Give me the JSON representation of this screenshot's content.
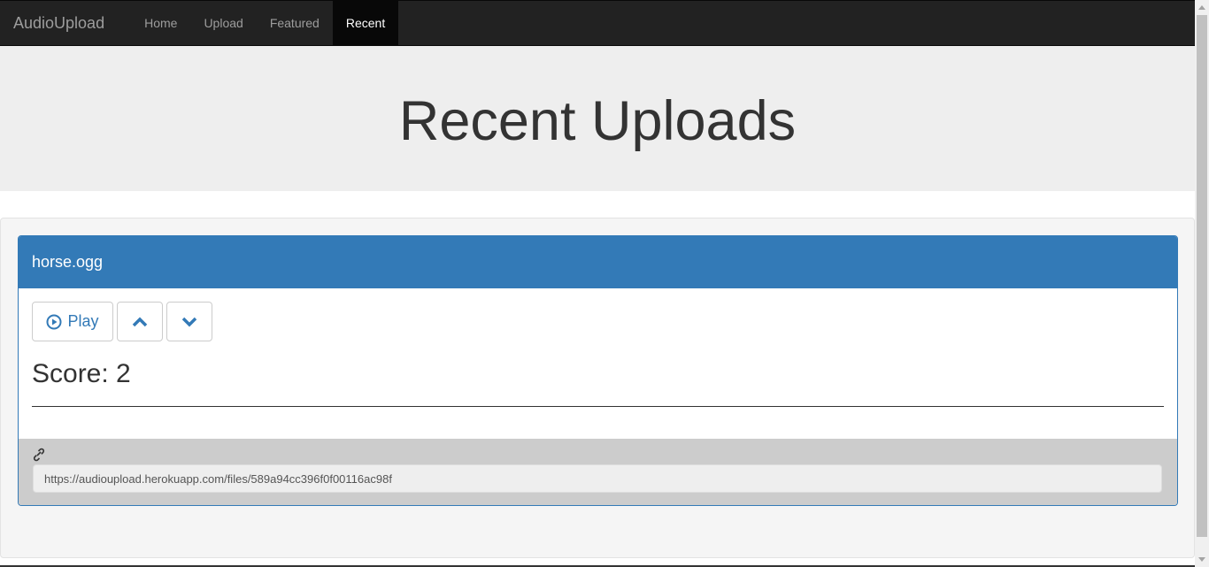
{
  "navbar": {
    "brand": "AudioUpload",
    "items": [
      {
        "label": "Home",
        "active": false
      },
      {
        "label": "Upload",
        "active": false
      },
      {
        "label": "Featured",
        "active": false
      },
      {
        "label": "Recent",
        "active": true
      }
    ]
  },
  "jumbotron": {
    "title": "Recent Uploads"
  },
  "upload": {
    "filename": "horse.ogg",
    "play_label": "Play",
    "score_label": "Score: 2",
    "link_url": "https://audioupload.herokuapp.com/files/589a94cc396f0f00116ac98f"
  },
  "icons": {
    "play": "play-circle-icon",
    "upvote": "chevron-up-icon",
    "downvote": "chevron-down-icon",
    "link": "link-icon"
  },
  "colors": {
    "primary": "#337ab7",
    "navbar": "#222222",
    "jumbotron": "#eeeeee"
  }
}
